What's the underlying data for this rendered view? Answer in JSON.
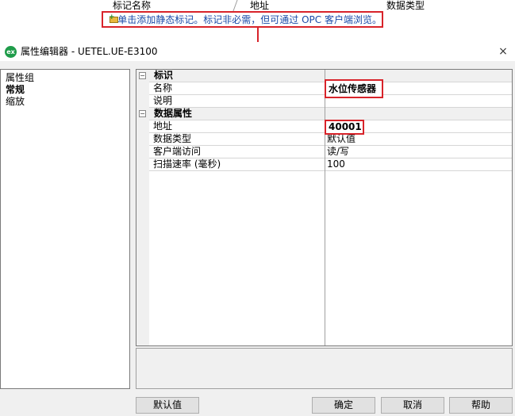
{
  "list_header": {
    "col1": "标记名称",
    "col2": "地址",
    "col3": "数据类型"
  },
  "hint": {
    "text": "单击添加静态标记。标记非必需，但可通过 OPC 客户端浏览。"
  },
  "dialog": {
    "title": "属性编辑器 - UETEL.UE-E3100",
    "logo": "ex",
    "close": "×"
  },
  "property_groups": {
    "header": "属性组",
    "items": [
      "常规",
      "缩放"
    ]
  },
  "grid": {
    "cat_ident": "标识",
    "name_label": "名称",
    "name_value": "水位传感器",
    "desc_label": "说明",
    "cat_data": "数据属性",
    "addr_label": "地址",
    "addr_value": "40001",
    "type_label": "数据类型",
    "type_value": "默认值",
    "access_label": "客户端访问",
    "access_value": "读/写",
    "scan_label": "扫描速率 (毫秒)",
    "scan_value": "100"
  },
  "buttons": {
    "defaults": "默认值",
    "ok": "确定",
    "cancel": "取消",
    "help": "帮助"
  },
  "colors": {
    "highlight": "#d8232a",
    "link_blue": "#1a4aa8"
  }
}
